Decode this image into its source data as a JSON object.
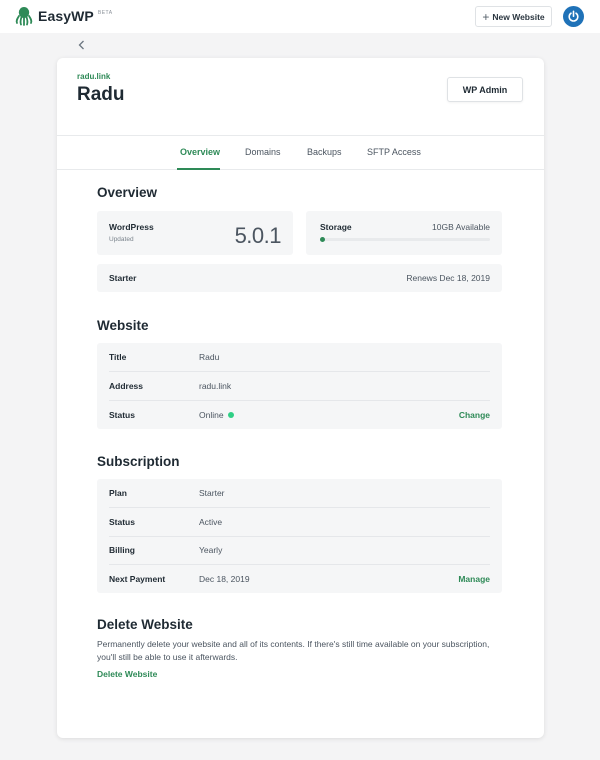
{
  "header": {
    "brand_name": "EasyWP",
    "brand_badge": "BETA",
    "new_website_label": "New Website"
  },
  "site": {
    "domain": "radu.link",
    "title": "Radu",
    "wp_admin_label": "WP Admin"
  },
  "tabs": [
    {
      "label": "Overview",
      "active": true
    },
    {
      "label": "Domains",
      "active": false
    },
    {
      "label": "Backups",
      "active": false
    },
    {
      "label": "SFTP Access",
      "active": false
    }
  ],
  "overview": {
    "title": "Overview",
    "wordpress": {
      "label": "WordPress",
      "sub": "Updated",
      "version": "5.0.1"
    },
    "storage": {
      "label": "Storage",
      "available": "10GB Available",
      "used_fraction": 0.02
    },
    "plan": {
      "label": "Starter",
      "renews": "Renews Dec 18, 2019"
    }
  },
  "website": {
    "title": "Website",
    "rows": [
      {
        "label": "Title",
        "value": "Radu"
      },
      {
        "label": "Address",
        "value": "radu.link"
      },
      {
        "label": "Status",
        "value": "Online",
        "action": "Change"
      }
    ]
  },
  "subscription": {
    "title": "Subscription",
    "rows": [
      {
        "label": "Plan",
        "value": "Starter"
      },
      {
        "label": "Status",
        "value": "Active"
      },
      {
        "label": "Billing",
        "value": "Yearly"
      },
      {
        "label": "Next Payment",
        "value": "Dec 18, 2019",
        "action": "Manage"
      }
    ]
  },
  "delete": {
    "title": "Delete Website",
    "description": "Permanently delete your website and all of its contents. If there's still time available on your subscription, you'll still be able to use it afterwards.",
    "link_label": "Delete Website"
  },
  "colors": {
    "accent_green": "#2e8a57",
    "status_online": "#2fcf85",
    "power_blue": "#1f72b8"
  },
  "icons": {
    "brand": "octopus-logo-icon",
    "new_website": "plus-icon",
    "account": "power-icon",
    "back": "chevron-left-icon"
  }
}
